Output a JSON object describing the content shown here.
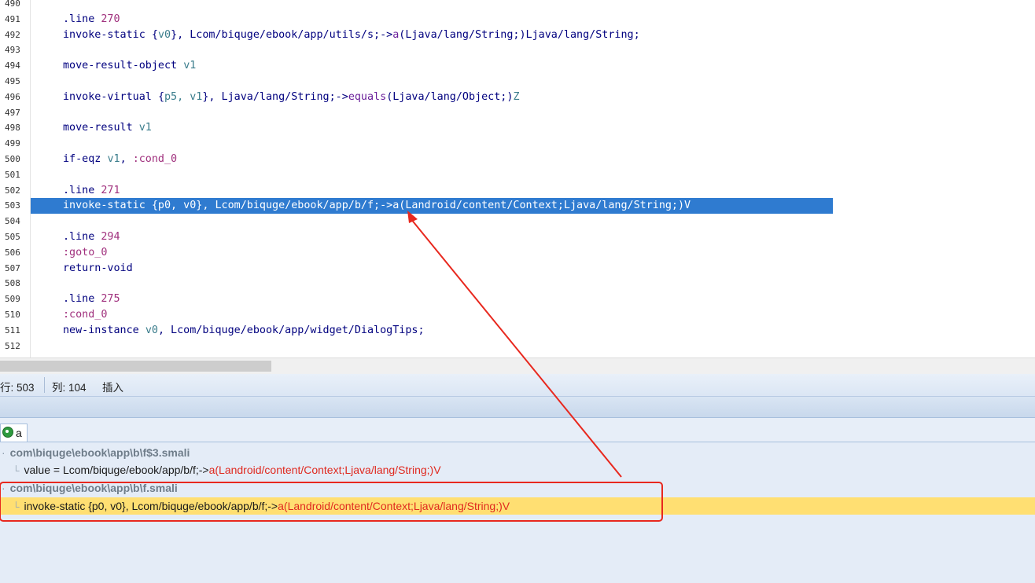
{
  "editor": {
    "lines": [
      {
        "num": "490",
        "parts": []
      },
      {
        "num": "491",
        "parts": [
          {
            "t": ".line ",
            "c": "kw"
          },
          {
            "t": "270",
            "c": "num"
          }
        ]
      },
      {
        "num": "492",
        "parts": [
          {
            "t": "invoke-static ",
            "c": "kw"
          },
          {
            "t": "{",
            "c": "plain"
          },
          {
            "t": "v0",
            "c": "reg"
          },
          {
            "t": "}, Lcom/biquge/ebook/app/utils/s;->",
            "c": "plain"
          },
          {
            "t": "a",
            "c": "meth"
          },
          {
            "t": "(Ljava/lang/String;)Ljava/lang/String;",
            "c": "plain"
          }
        ]
      },
      {
        "num": "493",
        "parts": []
      },
      {
        "num": "494",
        "parts": [
          {
            "t": "move-result-object ",
            "c": "kw"
          },
          {
            "t": "v1",
            "c": "reg"
          }
        ]
      },
      {
        "num": "495",
        "parts": []
      },
      {
        "num": "496",
        "parts": [
          {
            "t": "invoke-virtual ",
            "c": "kw"
          },
          {
            "t": "{",
            "c": "plain"
          },
          {
            "t": "p5, v1",
            "c": "reg"
          },
          {
            "t": "}, Ljava/lang/String;->",
            "c": "plain"
          },
          {
            "t": "equals",
            "c": "meth"
          },
          {
            "t": "(Ljava/lang/Object;)",
            "c": "plain"
          },
          {
            "t": "Z",
            "c": "reg"
          }
        ]
      },
      {
        "num": "497",
        "parts": []
      },
      {
        "num": "498",
        "parts": [
          {
            "t": "move-result ",
            "c": "kw"
          },
          {
            "t": "v1",
            "c": "reg"
          }
        ]
      },
      {
        "num": "499",
        "parts": []
      },
      {
        "num": "500",
        "parts": [
          {
            "t": "if-eqz ",
            "c": "kw"
          },
          {
            "t": "v1",
            "c": "reg"
          },
          {
            "t": ", ",
            "c": "plain"
          },
          {
            "t": ":cond_0",
            "c": "lbl"
          }
        ]
      },
      {
        "num": "501",
        "parts": []
      },
      {
        "num": "502",
        "parts": [
          {
            "t": ".line ",
            "c": "kw"
          },
          {
            "t": "271",
            "c": "num"
          }
        ]
      },
      {
        "num": "503",
        "selected": true,
        "parts": [
          {
            "t": "invoke-static {p0, v0}, Lcom/biquge/ebook/app/b/f;->a(Landroid/content/Context;Ljava/lang/String;)V",
            "c": "plain"
          }
        ]
      },
      {
        "num": "504",
        "parts": []
      },
      {
        "num": "505",
        "parts": [
          {
            "t": ".line ",
            "c": "kw"
          },
          {
            "t": "294",
            "c": "num"
          }
        ]
      },
      {
        "num": "506",
        "parts": [
          {
            "t": ":goto_0",
            "c": "lbl"
          }
        ]
      },
      {
        "num": "507",
        "parts": [
          {
            "t": "return-void",
            "c": "kw"
          }
        ]
      },
      {
        "num": "508",
        "parts": []
      },
      {
        "num": "509",
        "parts": [
          {
            "t": ".line ",
            "c": "kw"
          },
          {
            "t": "275",
            "c": "num"
          }
        ]
      },
      {
        "num": "510",
        "parts": [
          {
            "t": ":cond_0",
            "c": "lbl"
          }
        ]
      },
      {
        "num": "511",
        "parts": [
          {
            "t": "new-instance ",
            "c": "kw"
          },
          {
            "t": "v0",
            "c": "reg"
          },
          {
            "t": ", Lcom/biquge/ebook/app/widget/DialogTips;",
            "c": "plain"
          }
        ]
      },
      {
        "num": "512",
        "parts": []
      }
    ]
  },
  "statusbar": {
    "row": "行: 503",
    "col": "列: 104",
    "mode": "插入"
  },
  "results": {
    "tab_label": "a",
    "items": [
      {
        "type": "file",
        "text": "com\\biquge\\ebook\\app\\b\\f$3.smali"
      },
      {
        "type": "hit",
        "prefix": "value = Lcom/biquge/ebook/app/b/f;->",
        "match": "a(Landroid/content/Context;Ljava/lang/String;)V"
      },
      {
        "type": "file",
        "text": "com\\biquge\\ebook\\app\\b\\f.smali"
      },
      {
        "type": "hit",
        "prefix": "invoke-static {p0, v0}, Lcom/biquge/ebook/app/b/f;->",
        "match": "a(Landroid/content/Context;Ljava/lang/String;)V",
        "highlighted": true
      }
    ]
  },
  "colors": {
    "selection": "#2f7bd0",
    "annotation": "#e8281e",
    "highlight_row": "#ffdf72"
  }
}
